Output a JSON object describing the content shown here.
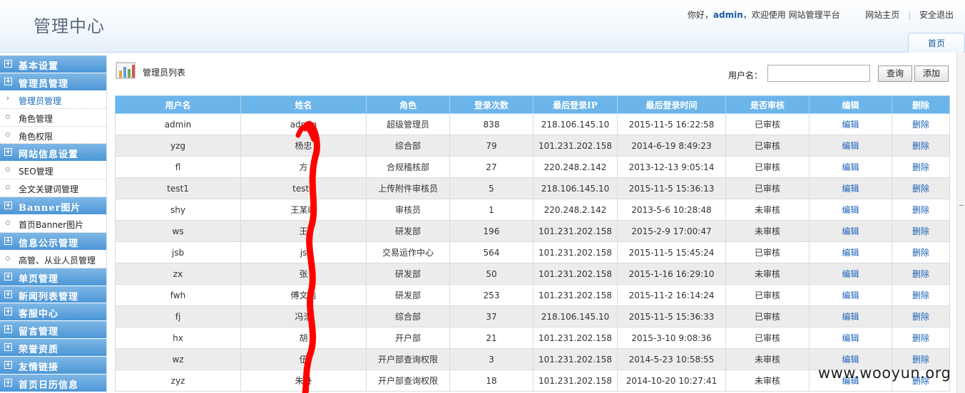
{
  "header": {
    "app_title": "管理中心",
    "greeting_prefix": "你好，",
    "username": "admin",
    "greeting_suffix": "，欢迎使用 网站管理平台",
    "site_home": "网站主页",
    "logout": "安全退出",
    "home_tab": "首页"
  },
  "sidebar": {
    "items": [
      {
        "type": "section",
        "label": "基本设置"
      },
      {
        "type": "section",
        "label": "管理员管理"
      },
      {
        "type": "sub",
        "label": "管理员管理",
        "active": true
      },
      {
        "type": "sub",
        "label": "角色管理"
      },
      {
        "type": "sub",
        "label": "角色权限"
      },
      {
        "type": "section",
        "label": "网站信息设置"
      },
      {
        "type": "sub",
        "label": "SEO管理"
      },
      {
        "type": "sub",
        "label": "全文关键词管理"
      },
      {
        "type": "section",
        "label": "Banner图片"
      },
      {
        "type": "sub",
        "label": "首页Banner图片"
      },
      {
        "type": "section",
        "label": "信息公示管理"
      },
      {
        "type": "sub",
        "label": "高管、从业人员管理"
      },
      {
        "type": "section",
        "label": "单页管理"
      },
      {
        "type": "section",
        "label": "新闻列表管理"
      },
      {
        "type": "section",
        "label": "客服中心"
      },
      {
        "type": "section",
        "label": "留言管理"
      },
      {
        "type": "section",
        "label": "荣誉资质"
      },
      {
        "type": "section",
        "label": "友情链接"
      },
      {
        "type": "section",
        "label": "首页日历信息"
      }
    ]
  },
  "main": {
    "list_title": "管理员列表",
    "search_label": "用户名：",
    "search_value": "",
    "query_button": "查询",
    "add_button": "添加"
  },
  "table": {
    "columns": [
      "用户名",
      "姓名",
      "角色",
      "登录次数",
      "最后登录IP",
      "最后登录时间",
      "是否审核",
      "编辑",
      "删除"
    ],
    "rows": [
      [
        "admin",
        "admin",
        "超级管理员",
        "838",
        "218.106.145.10",
        "2015-11-5 16:22:58",
        "已审核",
        "编辑",
        "删除"
      ],
      [
        "yzg",
        "杨忠",
        "综合部",
        "79",
        "101.231.202.158",
        "2014-6-19 8:49:23",
        "已审核",
        "编辑",
        "删除"
      ],
      [
        "fl",
        "方",
        "合规稽核部",
        "27",
        "220.248.2.142",
        "2013-12-13 9:05:14",
        "已审核",
        "编辑",
        "删除"
      ],
      [
        "test1",
        "test1",
        "上传附件审核员",
        "5",
        "218.106.145.10",
        "2015-11-5 15:36:13",
        "已审核",
        "编辑",
        "删除"
      ],
      [
        "shy",
        "王某峰",
        "审核员",
        "1",
        "220.248.2.142",
        "2013-5-6 10:28:48",
        "未审核",
        "编辑",
        "删除"
      ],
      [
        "ws",
        "王",
        "研发部",
        "196",
        "101.231.202.158",
        "2015-2-9 17:00:47",
        "未审核",
        "编辑",
        "删除"
      ],
      [
        "jsb",
        "js",
        "交易运作中心",
        "564",
        "101.231.202.158",
        "2015-11-5 15:45:24",
        "已审核",
        "编辑",
        "删除"
      ],
      [
        "zx",
        "张",
        "研发部",
        "50",
        "101.231.202.158",
        "2015-1-16 16:29:10",
        "未审核",
        "编辑",
        "删除"
      ],
      [
        "fwh",
        "傅文浩",
        "研发部",
        "253",
        "101.231.202.158",
        "2015-11-2 16:14:24",
        "已审核",
        "编辑",
        "删除"
      ],
      [
        "fj",
        "冯浩",
        "综合部",
        "37",
        "218.106.145.10",
        "2015-11-5 15:36:33",
        "已审核",
        "编辑",
        "删除"
      ],
      [
        "hx",
        "胡",
        "开户部",
        "21",
        "101.231.202.158",
        "2015-3-10 9:08:36",
        "已审核",
        "编辑",
        "删除"
      ],
      [
        "wz",
        "伍",
        "开户部查询权限",
        "3",
        "101.231.202.158",
        "2014-5-23 10:58:55",
        "未审核",
        "编辑",
        "删除"
      ],
      [
        "zyz",
        "朱舟",
        "开户部查询权限",
        "18",
        "101.231.202.158",
        "2014-10-20 10:27:41",
        "未审核",
        "编辑",
        "删除"
      ]
    ]
  },
  "watermark": "www.wooyun.org",
  "colors": {
    "header_bg": "#eef5fc",
    "sidebar_section": "#5aa2dc",
    "table_header": "#6cb5ea",
    "link": "#1a62b8",
    "annotation": "#ff0000"
  }
}
